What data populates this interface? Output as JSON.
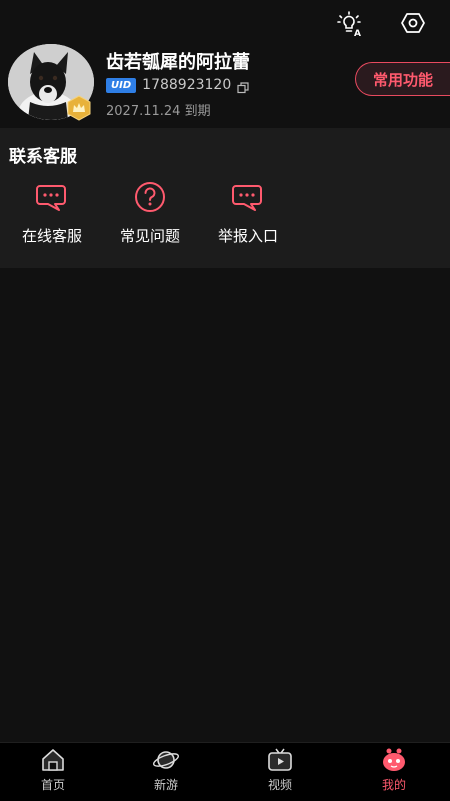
{
  "profile": {
    "username": "齿若瓠犀的阿拉蕾",
    "uid_tag": "UID",
    "uid": "1788923120",
    "expiry": "2027.11.24 到期",
    "function_button": "常用功能"
  },
  "support": {
    "title": "联系客服",
    "items": [
      {
        "label": "在线客服",
        "icon": "chat-bubble-icon"
      },
      {
        "label": "常见问题",
        "icon": "question-circle-icon"
      },
      {
        "label": "举报入口",
        "icon": "chat-bubble-icon"
      }
    ]
  },
  "tabbar": {
    "items": [
      {
        "label": "首页",
        "icon": "home-icon"
      },
      {
        "label": "新游",
        "icon": "planet-icon"
      },
      {
        "label": "视频",
        "icon": "tv-icon"
      },
      {
        "label": "我的",
        "icon": "mascot-icon"
      }
    ],
    "active_index": 3
  },
  "colors": {
    "accent": "#ff5a6e",
    "background": "#111111",
    "card": "#1c1c1c",
    "uid_tag": "#2f7fe6"
  }
}
